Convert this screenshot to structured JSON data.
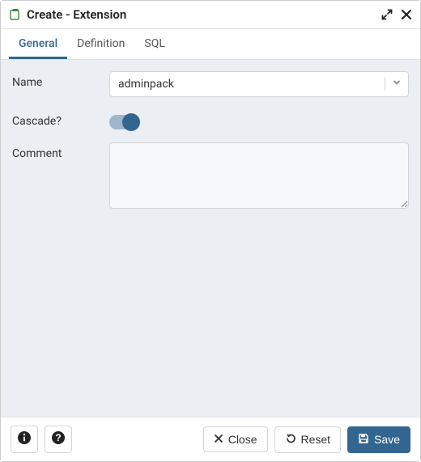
{
  "window": {
    "title": "Create - Extension"
  },
  "tabs": {
    "general": "General",
    "definition": "Definition",
    "sql": "SQL",
    "active": "general"
  },
  "form": {
    "name_label": "Name",
    "name_value": "adminpack",
    "cascade_label": "Cascade?",
    "cascade_on": true,
    "comment_label": "Comment",
    "comment_value": ""
  },
  "footer": {
    "close_label": "Close",
    "reset_label": "Reset",
    "save_label": "Save"
  }
}
